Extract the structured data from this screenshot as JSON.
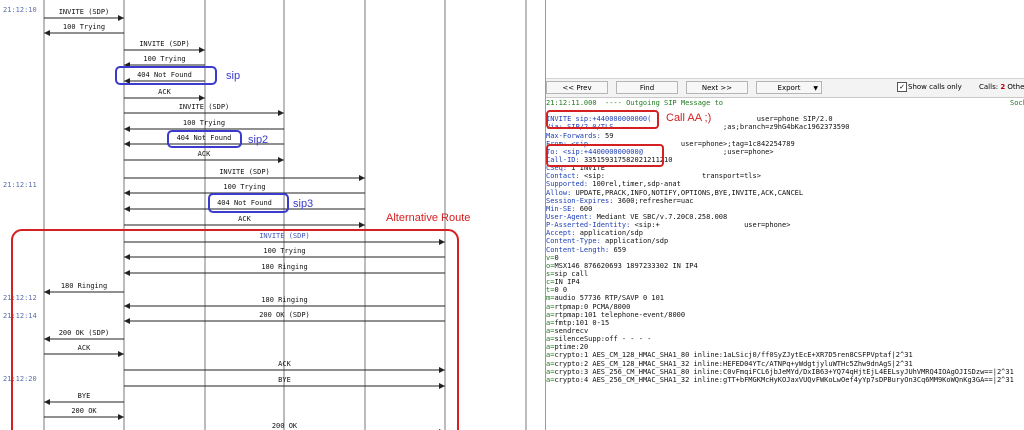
{
  "ladder": {
    "timestamps": [
      {
        "text": "21:12:10"
      },
      {
        "text": "21:12:11"
      },
      {
        "text": "21:12:12"
      },
      {
        "text": "21:12:14"
      },
      {
        "text": "21:12:20"
      }
    ],
    "messages": [
      {
        "label": "INVITE (SDP)"
      },
      {
        "label": "100 Trying"
      },
      {
        "label": "INVITE (SDP)"
      },
      {
        "label": "100 Trying"
      },
      {
        "label": "404 Not Found"
      },
      {
        "label": "ACK"
      },
      {
        "label": "INVITE (SDP)"
      },
      {
        "label": "100 Trying"
      },
      {
        "label": "404 Not Found"
      },
      {
        "label": "ACK"
      },
      {
        "label": "INVITE (SDP)"
      },
      {
        "label": "100 Trying"
      },
      {
        "label": "404 Not Found"
      },
      {
        "label": "ACK"
      },
      {
        "label": "INVITE (SDP)"
      },
      {
        "label": "100 Trying"
      },
      {
        "label": "180 Ringing"
      },
      {
        "label": "180 Ringing"
      },
      {
        "label": "180 Ringing"
      },
      {
        "label": "200 OK (SDP)"
      },
      {
        "label": "200 OK (SDP)"
      },
      {
        "label": "ACK"
      },
      {
        "label": "ACK"
      },
      {
        "label": "BYE"
      },
      {
        "label": "BYE"
      },
      {
        "label": "200 OK"
      },
      {
        "label": "200 OK"
      }
    ],
    "annotations": {
      "sip": "sip",
      "sip2": "sip2",
      "sip3": "sip3",
      "alt_route": "Alternative Route"
    }
  },
  "toolbar": {
    "prev_label": "<< Prev",
    "find_label": "Find",
    "next_label": "Next >>",
    "export_label": "Export",
    "show_calls_only": "Show calls only",
    "calls_label": "Calls:",
    "calls_count": "2",
    "others_label": "Other:"
  },
  "detail": {
    "header": "21:12:11.000  ---- Outgoing SIP Message to",
    "header_right": "Sock",
    "call_annotation": "Call AA ;)",
    "lines": [
      {
        "k": "INVITE sip:+440000000000(",
        "v": "                         user=phone SIP/2.0"
      },
      {
        "k": "Via: SIP/2.0/TLS",
        "v": "                          ;as;branch=z9hG4bKac1962373590"
      },
      {
        "k": "Max-Forwards: ",
        "v": "59"
      },
      {
        "k": "From: <sip",
        "v": "                      user=phone>;tag=1c842254789"
      },
      {
        "k": "To: <sip:+440000000000@",
        "v": "                   ;user=phone>"
      },
      {
        "k": "Call-ID: ",
        "v": "335159317582021211210"
      },
      {
        "k": "CSeq: ",
        "v": "1 INVITE"
      },
      {
        "k": "Contact: ",
        "v": "<sip:                       transport=tls>"
      },
      {
        "k": "Supported: ",
        "v": "100rel,timer,sdp-anat"
      },
      {
        "k": "Allow: ",
        "v": "UPDATE,PRACK,INFO,NOTIFY,OPTIONS,BYE,INVITE,ACK,CANCEL"
      },
      {
        "k": "Session-Expires: ",
        "v": "3600;refresher=uac"
      },
      {
        "k": "Min-SE: ",
        "v": "600"
      },
      {
        "k": "User-Agent: ",
        "v": "Mediant VE SBC/v.7.20C0.258.008"
      },
      {
        "k": "P-Asserted-Identity: ",
        "v": "<sip:+                    user=phone>"
      },
      {
        "k": "Accept: ",
        "v": "application/sdp"
      },
      {
        "k": "Content-Type: ",
        "v": "application/sdp"
      },
      {
        "k": "Content-Length: ",
        "v": "659"
      }
    ],
    "sdp": [
      {
        "k": "v=",
        "v": "0"
      },
      {
        "k": "o=",
        "v": "MSX146 876620693 1897233302 IN IP4"
      },
      {
        "k": "s=",
        "v": "sip call"
      },
      {
        "k": "c=",
        "v": "IN IP4"
      },
      {
        "k": "t=",
        "v": "0 0"
      },
      {
        "k": "m=",
        "v": "audio 57736 RTP/SAVP 0 101"
      },
      {
        "k": "a=",
        "v": "rtpmap:0 PCMA/8000"
      },
      {
        "k": "a=",
        "v": "rtpmap:101 telephone-event/8000"
      },
      {
        "k": "a=",
        "v": "fmtp:101 0-15"
      },
      {
        "k": "a=",
        "v": "sendrecv"
      },
      {
        "k": "a=",
        "v": "silenceSupp:off - - - -"
      },
      {
        "k": "a=",
        "v": "ptime:20"
      },
      {
        "k": "a=",
        "v": "crypto:1 AES_CM_128_HMAC_SHA1_80 inline:1aLSicj0/ff0SyZJytEcE+XR7D5ren8CSFPVptaf|2^31"
      },
      {
        "k": "a=",
        "v": "crypto:2 AES_CM_128_HMAC_SHA1_32 inline:HEFED04YTc/ATNPq+yWdgtjyluWTHc5Zhw9dnAgS|2^31"
      },
      {
        "k": "a=",
        "v": "crypto:3 AES_256_CM_HMAC_SHA1_80 inline:C0vFmqiFCL6jbJeMYd/DxIB63+YQ74qHjtEjL4EELsyJUhVMRQ4IOAgOJISDzw==|2^31"
      },
      {
        "k": "a=",
        "v": "crypto:4 AES_256_CM_HMAC_SHA1_32 inline:gTT+bFMGKMcHyKOJaxVUQvFWKoLwOef4yYp7sDPBuryOn3Cq6MM9KoWQnKg3GA==|2^31"
      }
    ]
  },
  "colors": {
    "accent_red": "#d42020",
    "annot_blue": "#3a3acc",
    "timestamp_blue": "#5a6fae",
    "invite_highlight": "#3e57b5"
  }
}
